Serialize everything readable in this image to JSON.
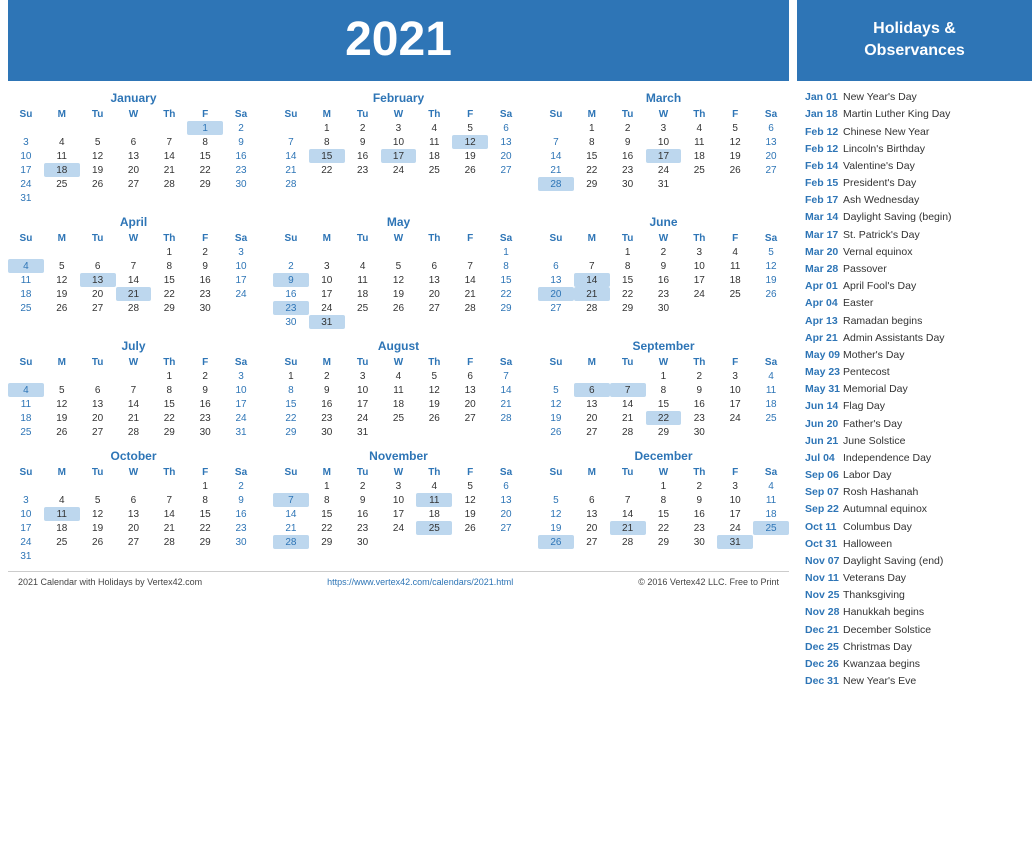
{
  "header": {
    "year": "2021"
  },
  "sidebar": {
    "title": "Holidays &\nObservances",
    "holidays": [
      {
        "date": "Jan 01",
        "name": "New Year's Day"
      },
      {
        "date": "Jan 18",
        "name": "Martin Luther King Day"
      },
      {
        "date": "Feb 12",
        "name": "Chinese New Year"
      },
      {
        "date": "Feb 12",
        "name": "Lincoln's Birthday"
      },
      {
        "date": "Feb 14",
        "name": "Valentine's Day"
      },
      {
        "date": "Feb 15",
        "name": "President's Day"
      },
      {
        "date": "Feb 17",
        "name": "Ash Wednesday"
      },
      {
        "date": "Mar 14",
        "name": "Daylight Saving (begin)"
      },
      {
        "date": "Mar 17",
        "name": "St. Patrick's Day"
      },
      {
        "date": "Mar 20",
        "name": "Vernal equinox"
      },
      {
        "date": "Mar 28",
        "name": "Passover"
      },
      {
        "date": "Apr 01",
        "name": "April Fool's Day"
      },
      {
        "date": "Apr 04",
        "name": "Easter"
      },
      {
        "date": "Apr 13",
        "name": "Ramadan begins"
      },
      {
        "date": "Apr 21",
        "name": "Admin Assistants Day"
      },
      {
        "date": "May 09",
        "name": "Mother's Day"
      },
      {
        "date": "May 23",
        "name": "Pentecost"
      },
      {
        "date": "May 31",
        "name": "Memorial Day"
      },
      {
        "date": "Jun 14",
        "name": "Flag Day"
      },
      {
        "date": "Jun 20",
        "name": "Father's Day"
      },
      {
        "date": "Jun 21",
        "name": "June Solstice"
      },
      {
        "date": "Jul 04",
        "name": "Independence Day"
      },
      {
        "date": "Sep 06",
        "name": "Labor Day"
      },
      {
        "date": "Sep 07",
        "name": "Rosh Hashanah"
      },
      {
        "date": "Sep 22",
        "name": "Autumnal equinox"
      },
      {
        "date": "Oct 11",
        "name": "Columbus Day"
      },
      {
        "date": "Oct 31",
        "name": "Halloween"
      },
      {
        "date": "Nov 07",
        "name": "Daylight Saving (end)"
      },
      {
        "date": "Nov 11",
        "name": "Veterans Day"
      },
      {
        "date": "Nov 25",
        "name": "Thanksgiving"
      },
      {
        "date": "Nov 28",
        "name": "Hanukkah begins"
      },
      {
        "date": "Dec 21",
        "name": "December Solstice"
      },
      {
        "date": "Dec 25",
        "name": "Christmas Day"
      },
      {
        "date": "Dec 26",
        "name": "Kwanzaa begins"
      },
      {
        "date": "Dec 31",
        "name": "New Year's Eve"
      }
    ]
  },
  "footer": {
    "left": "2021 Calendar with Holidays by Vertex42.com",
    "center": "https://www.vertex42.com/calendars/2021.html",
    "right": "© 2016 Vertex42 LLC. Free to Print"
  }
}
